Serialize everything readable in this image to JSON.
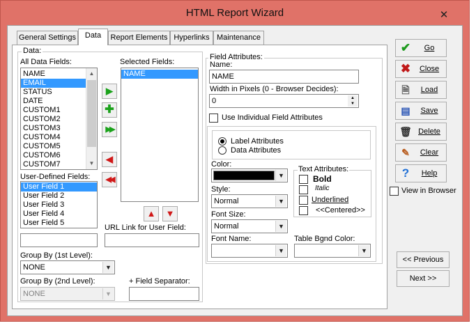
{
  "window": {
    "title": "HTML Report Wizard",
    "close_glyph": "✕"
  },
  "tabs": [
    {
      "label": "General Settings",
      "active": false
    },
    {
      "label": "Data",
      "active": true
    },
    {
      "label": "Report Elements",
      "active": false
    },
    {
      "label": "Hyperlinks",
      "active": false
    },
    {
      "label": "Maintenance",
      "active": false
    }
  ],
  "data_group": {
    "label": "Data:"
  },
  "all_fields": {
    "label": "All Data Fields:",
    "items": [
      "NAME",
      "EMAIL",
      "STATUS",
      "DATE",
      "CUSTOM1",
      "CUSTOM2",
      "CUSTOM3",
      "CUSTOM4",
      "CUSTOM5",
      "CUSTOM6",
      "CUSTOM7"
    ],
    "selected": "EMAIL"
  },
  "selected_fields": {
    "label": "Selected Fields:",
    "items": [
      "NAME"
    ],
    "selected": "NAME"
  },
  "user_defined": {
    "label": "User-Defined Fields:",
    "items": [
      "User Field 1",
      "User Field 2",
      "User Field 3",
      "User Field 4",
      "User Field 5"
    ],
    "selected": "User Field 1",
    "new_field_value": ""
  },
  "url_link": {
    "label": "URL Link for User Field:",
    "value": ""
  },
  "group_by_1": {
    "label": "Group By (1st Level):",
    "value": "NONE"
  },
  "group_by_2": {
    "label": "Group By (2nd Level):",
    "value": "NONE",
    "disabled": true
  },
  "field_separator": {
    "label": "+ Field Separator:",
    "value": ""
  },
  "field_attributes": {
    "label": "Field Attributes:",
    "name_label": "Name:",
    "name_value": "NAME",
    "width_label": "Width in Pixels (0 - Browser Decides):",
    "width_value": "0",
    "use_individual_label": "Use Individual Field Attributes",
    "use_individual_checked": false,
    "label_attributes": "Label Attributes",
    "data_attributes": "Data Attributes",
    "attributes_mode": "label",
    "color_label": "Color:",
    "color_value": "#000000",
    "style_label": "Style:",
    "style_value": "Normal",
    "font_size_label": "Font Size:",
    "font_size_value": "Normal",
    "font_name_label": "Font Name:",
    "font_name_value": "",
    "table_bgnd_label": "Table Bgnd Color:",
    "table_bgnd_value": "",
    "text_attributes": {
      "label": "Text Attributes:",
      "bold": "Bold",
      "italic": "Italic",
      "underlined": "Underlined",
      "centered": "<<Centered>>"
    }
  },
  "buttons": {
    "go": "Go",
    "close": "Close",
    "load": "Load",
    "save": "Save",
    "delete": "Delete",
    "clear": "Clear",
    "help": "Help",
    "view_in_browser": "View in Browser",
    "previous": "<< Previous",
    "next": "Next >>"
  },
  "colors": {
    "titlebar": "#e07268",
    "selection": "#3399ff",
    "go_icon": "#1c9a1c",
    "close_icon": "#c01818",
    "move_arrow": "#1ba21b",
    "remove_arrow": "#d01818",
    "help_icon": "#1f6fd6"
  }
}
